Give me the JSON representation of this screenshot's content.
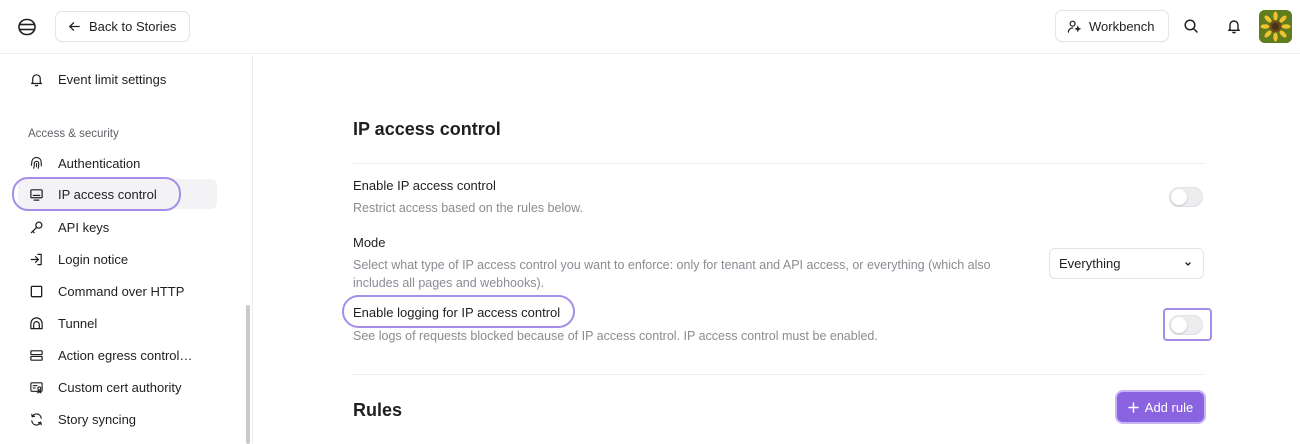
{
  "header": {
    "back_label": "Back to Stories",
    "workbench_label": "Workbench"
  },
  "sidebar": {
    "items_top": [
      {
        "label": "Event limit settings",
        "icon": "bell-icon"
      }
    ],
    "section_label": "Access & security",
    "items": [
      {
        "label": "Authentication",
        "icon": "fingerprint-icon"
      },
      {
        "label": "IP access control",
        "icon": "monitor-icon",
        "active": true
      },
      {
        "label": "API keys",
        "icon": "key-icon"
      },
      {
        "label": "Login notice",
        "icon": "login-icon"
      },
      {
        "label": "Command over HTTP",
        "icon": "square-icon"
      },
      {
        "label": "Tunnel",
        "icon": "tunnel-icon"
      },
      {
        "label": "Action egress control…",
        "icon": "server-icon"
      },
      {
        "label": "Custom cert authority",
        "icon": "certificate-icon"
      },
      {
        "label": "Story syncing",
        "icon": "sync-icon"
      }
    ]
  },
  "main": {
    "title": "IP access control",
    "enable": {
      "title": "Enable IP access control",
      "desc": "Restrict access based on the rules below.",
      "enabled": false
    },
    "mode": {
      "title": "Mode",
      "desc_line1": "Select what type of IP access control you want to enforce: only for tenant and API access, or everything (which also",
      "desc_line2": "includes all pages and webhooks).",
      "selected": "Everything"
    },
    "logging": {
      "title": "Enable logging for IP access control",
      "desc": "See logs of requests blocked because of IP access control. IP access control must be enabled.",
      "enabled": false
    },
    "rules_title": "Rules",
    "add_rule_label": "Add rule"
  },
  "colors": {
    "accent": "#8a63e0",
    "highlight": "#a58ee8"
  }
}
